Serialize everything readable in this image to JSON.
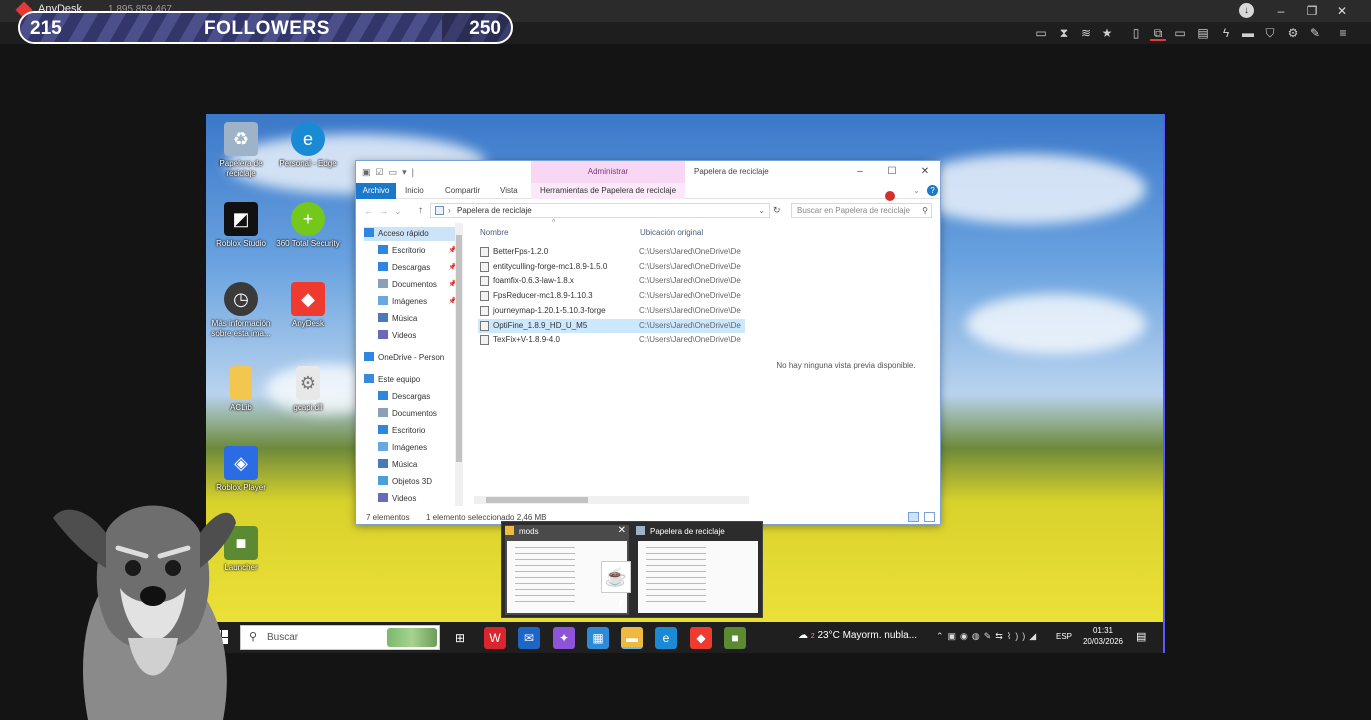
{
  "anydesk": {
    "title": "AnyDesk",
    "address": "1 895 859 467",
    "toolbar_icons": [
      "chat-icon",
      "hourglass-icon",
      "database-icon",
      "star-icon",
      "file-icon",
      "monitor-switch-icon",
      "display-icon",
      "message-icon",
      "lightning-icon",
      "keyboard-icon",
      "shield-icon",
      "settings-icon",
      "pen-icon",
      "menu-icon"
    ],
    "window_buttons": [
      "–",
      "❐",
      "✕"
    ]
  },
  "followers": {
    "current": "215",
    "label": "FOLLOWERS",
    "goal": "250",
    "progress": 0.86
  },
  "desktop": {
    "icons": [
      {
        "label": "Papelera de reciclaje",
        "icon": "recycle-bin-icon",
        "color": "#9fb3c8"
      },
      {
        "label": "Personal - Edge",
        "icon": "edge-icon",
        "color": "#1b8ad4"
      },
      {
        "label": "Roblox Studio",
        "icon": "roblox-studio-icon",
        "color": "#111111"
      },
      {
        "label": "360 Total Security",
        "icon": "security-360-icon",
        "color": "#74c71b"
      },
      {
        "label": "Más información sobre esta ima...",
        "icon": "spotlight-icon",
        "color": "#3a3a3a"
      },
      {
        "label": "AnyDesk",
        "icon": "anydesk-icon",
        "color": "#ef3b2f"
      },
      {
        "label": "ACLib",
        "icon": "folder-icon",
        "color": "#f3c64f"
      },
      {
        "label": "gcapi.dll",
        "icon": "dll-file-icon",
        "color": "#e8e8e8"
      },
      {
        "label": "Roblox Player",
        "icon": "roblox-player-icon",
        "color": "#2b6be3"
      },
      {
        "label": "Launcher",
        "icon": "minecraft-launcher-icon",
        "color": "#5b8a32"
      }
    ]
  },
  "explorer": {
    "title": "Papelera de reciclaje",
    "context_tab": "Administrar",
    "ribbon_tabs": [
      "Archivo",
      "Inicio",
      "Compartir",
      "Vista",
      "Herramientas de Papelera de reciclaje"
    ],
    "path": "Papelera de reciclaje",
    "search_placeholder": "Buscar en Papelera de reciclaje",
    "nav": [
      {
        "label": "Acceso rápido",
        "icon": "star-icon",
        "selected": true,
        "indent": 0,
        "pinned": false
      },
      {
        "label": "Escritorio",
        "icon": "desktop-folder-icon",
        "selected": false,
        "indent": 1,
        "pinned": true
      },
      {
        "label": "Descargas",
        "icon": "downloads-icon",
        "selected": false,
        "indent": 1,
        "pinned": true
      },
      {
        "label": "Documentos",
        "icon": "documents-icon",
        "selected": false,
        "indent": 1,
        "pinned": true
      },
      {
        "label": "Imágenes",
        "icon": "pictures-icon",
        "selected": false,
        "indent": 1,
        "pinned": true
      },
      {
        "label": "Música",
        "icon": "music-icon",
        "selected": false,
        "indent": 1,
        "pinned": false
      },
      {
        "label": "Videos",
        "icon": "videos-icon",
        "selected": false,
        "indent": 1,
        "pinned": false
      },
      {
        "label": "OneDrive - Person",
        "icon": "onedrive-icon",
        "selected": false,
        "indent": 0,
        "pinned": false
      },
      {
        "label": "Este equipo",
        "icon": "computer-icon",
        "selected": false,
        "indent": 0,
        "pinned": false
      },
      {
        "label": "Descargas",
        "icon": "downloads-icon",
        "selected": false,
        "indent": 1,
        "pinned": false
      },
      {
        "label": "Documentos",
        "icon": "documents-icon",
        "selected": false,
        "indent": 1,
        "pinned": false
      },
      {
        "label": "Escritorio",
        "icon": "desktop-folder-icon",
        "selected": false,
        "indent": 1,
        "pinned": false
      },
      {
        "label": "Imágenes",
        "icon": "pictures-icon",
        "selected": false,
        "indent": 1,
        "pinned": false
      },
      {
        "label": "Música",
        "icon": "music-icon",
        "selected": false,
        "indent": 1,
        "pinned": false
      },
      {
        "label": "Objetos 3D",
        "icon": "objects-3d-icon",
        "selected": false,
        "indent": 1,
        "pinned": false
      },
      {
        "label": "Videos",
        "icon": "videos-icon",
        "selected": false,
        "indent": 1,
        "pinned": false
      }
    ],
    "columns": [
      "Nombre",
      "Ubicación original"
    ],
    "files": [
      {
        "name": "BetterFps-1.2.0",
        "origin": "C:\\Users\\Jared\\OneDrive\\De",
        "selected": false
      },
      {
        "name": "entityculling-forge-mc1.8.9-1.5.0",
        "origin": "C:\\Users\\Jared\\OneDrive\\De",
        "selected": false
      },
      {
        "name": "foamfix-0.6.3-law-1.8.x",
        "origin": "C:\\Users\\Jared\\OneDrive\\De",
        "selected": false
      },
      {
        "name": "FpsReducer-mc1.8.9-1.10.3",
        "origin": "C:\\Users\\Jared\\OneDrive\\De",
        "selected": false
      },
      {
        "name": "journeymap-1.20.1-5.10.3-forge",
        "origin": "C:\\Users\\Jared\\OneDrive\\De",
        "selected": false
      },
      {
        "name": "OptiFine_1.8.9_HD_U_M5",
        "origin": "C:\\Users\\Jared\\OneDrive\\De",
        "selected": true
      },
      {
        "name": "TexFix+V-1.8.9-4.0",
        "origin": "C:\\Users\\Jared\\OneDrive\\De",
        "selected": false
      }
    ],
    "preview_text": "No hay ninguna vista previa disponible.",
    "status_count": "7 elementos",
    "status_selection": "1 elemento seleccionado  2,46 MB"
  },
  "thumbnails": [
    {
      "title": "mods",
      "icon": "folder-icon"
    },
    {
      "title": "Papelera de reciclaje",
      "icon": "recycle-bin-icon"
    }
  ],
  "taskbar": {
    "search_placeholder": "Buscar",
    "apps": [
      {
        "name": "task-view-icon",
        "color": "#1f1f1f",
        "glyph": "⊞",
        "active": false
      },
      {
        "name": "wps-icon",
        "color": "#d9262e",
        "glyph": "W",
        "active": false
      },
      {
        "name": "outlook-icon",
        "color": "#1e66c6",
        "glyph": "✉",
        "active": false
      },
      {
        "name": "copilot-icon",
        "color": "#8c54d6",
        "glyph": "✦",
        "active": false
      },
      {
        "name": "store-icon",
        "color": "#2d8ad7",
        "glyph": "▦",
        "active": false
      },
      {
        "name": "file-explorer-icon",
        "color": "#f0b93f",
        "glyph": "▬",
        "active": true
      },
      {
        "name": "edge-icon",
        "color": "#1b8ad4",
        "glyph": "e",
        "active": false
      },
      {
        "name": "anydesk-icon",
        "color": "#ef3b2f",
        "glyph": "◆",
        "active": false
      },
      {
        "name": "minecraft-icon",
        "color": "#5b8a32",
        "glyph": "■",
        "active": false
      }
    ],
    "weather_temp": "23°C",
    "weather_desc": "Mayorm. nubla...",
    "weather_badge": "2",
    "language": "ESP",
    "time": "01:31",
    "date": "20/03/2026"
  },
  "colors": {
    "anydesk_red": "#e53935",
    "explorer_blue": "#1979ca",
    "selection": "#cce8ff",
    "context_pink": "#f7d7f3"
  }
}
